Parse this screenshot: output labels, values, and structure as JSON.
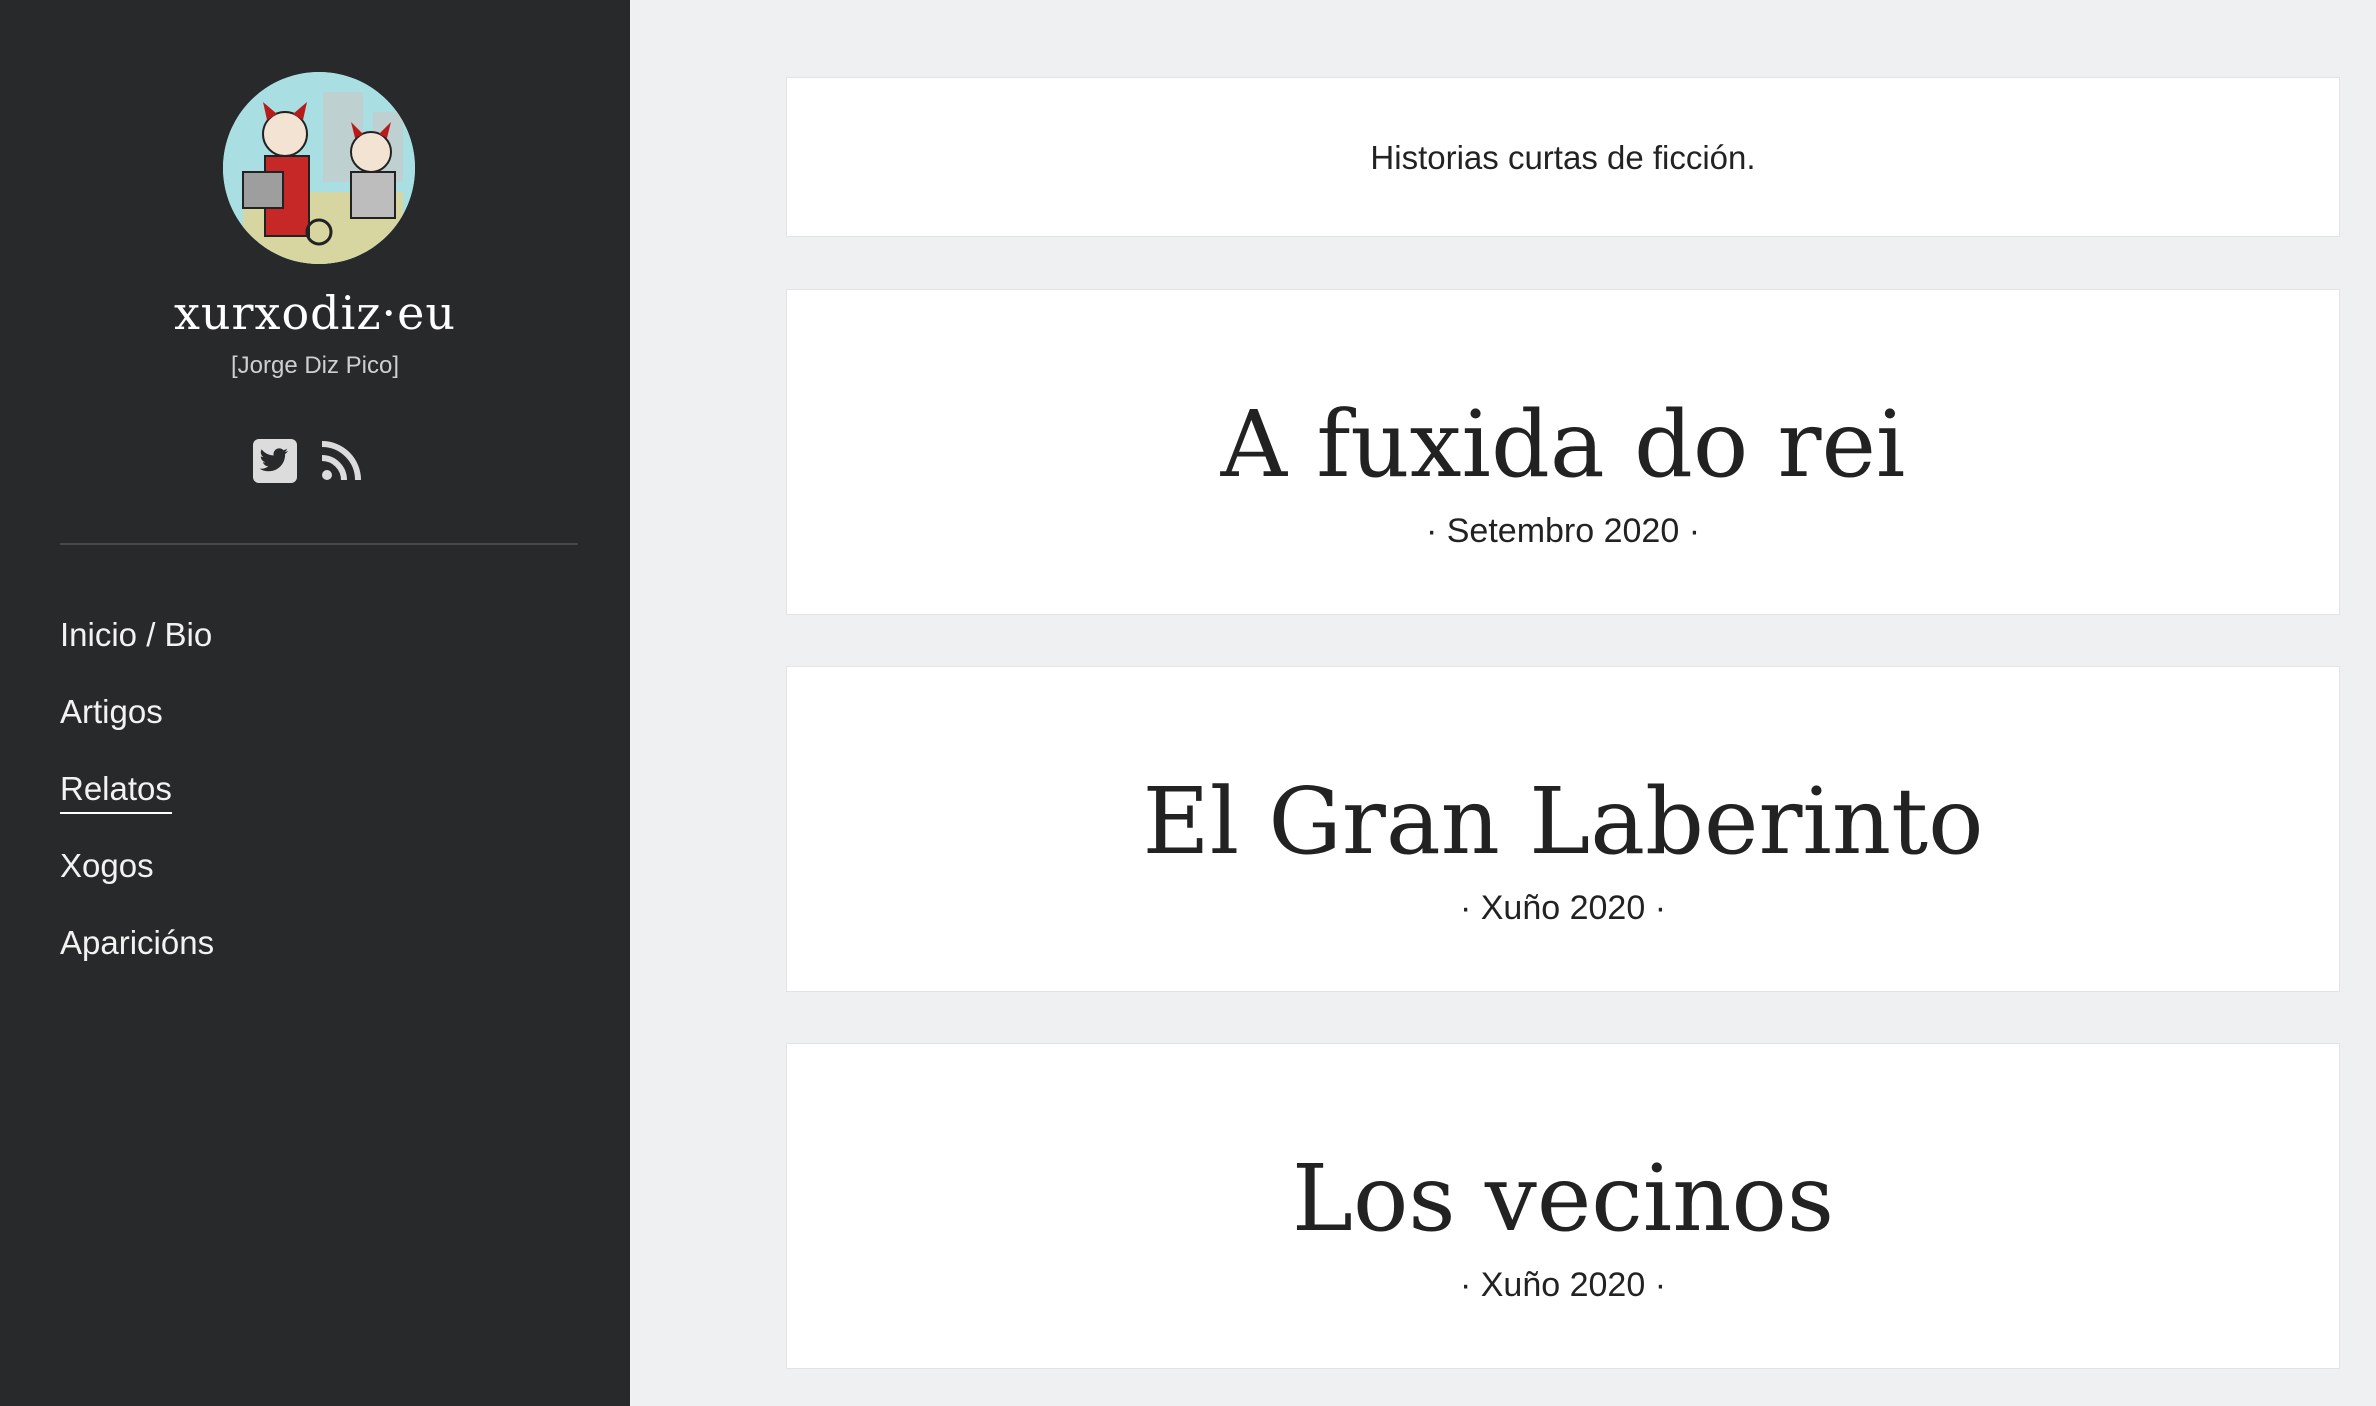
{
  "sidebar": {
    "title": "xurxodiz·eu",
    "subtitle": "[Jorge Diz Pico]",
    "social": [
      {
        "icon": "twitter-icon"
      },
      {
        "icon": "rss-icon"
      }
    ],
    "nav": [
      {
        "label": "Inicio / Bio",
        "active": false
      },
      {
        "label": "Artigos",
        "active": false
      },
      {
        "label": "Relatos",
        "active": true
      },
      {
        "label": "Xogos",
        "active": false
      },
      {
        "label": "Aparicións",
        "active": false
      }
    ]
  },
  "main": {
    "intro": "Historias curtas de ficción.",
    "stories": [
      {
        "title": "A fuxida do rei",
        "date": "· Setembro 2020 ·"
      },
      {
        "title": "El Gran Laberinto",
        "date": "· Xuño 2020 ·"
      },
      {
        "title": "Los vecinos",
        "date": "· Xuño 2020 ·"
      }
    ]
  },
  "colors": {
    "sidebar_bg": "#27292b",
    "page_bg": "#eff0f1",
    "card_bg": "#ffffff",
    "text": "#222222"
  }
}
